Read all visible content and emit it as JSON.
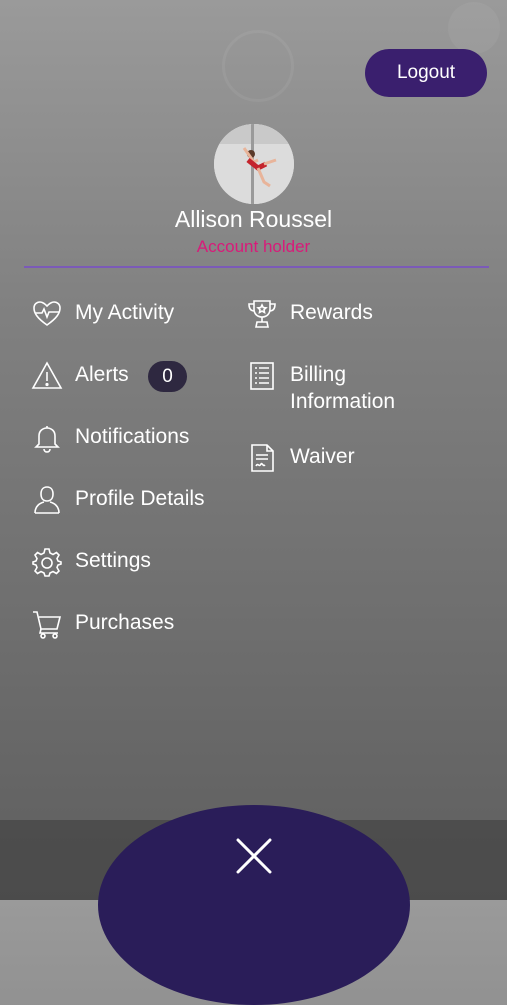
{
  "header": {
    "logout_label": "Logout"
  },
  "user": {
    "name": "Allison Roussel",
    "role": "Account holder"
  },
  "menu": {
    "left": [
      {
        "label": "My Activity",
        "icon": "heart-pulse-icon"
      },
      {
        "label": "Alerts",
        "icon": "warning-icon"
      },
      {
        "label": "Notifications",
        "icon": "bell-icon"
      },
      {
        "label": "Profile Details",
        "icon": "person-icon"
      },
      {
        "label": "Settings",
        "icon": "gear-icon"
      },
      {
        "label": "Purchases",
        "icon": "cart-icon"
      }
    ],
    "right": [
      {
        "label": "Rewards",
        "icon": "trophy-icon"
      },
      {
        "label": "Billing\nInformation",
        "icon": "document-list-icon"
      },
      {
        "label": "Waiver",
        "icon": "document-signature-icon"
      }
    ]
  },
  "alerts_count": "0",
  "colors": {
    "accent": "#3a1f6e",
    "role_text": "#d81b7a",
    "divider": "#7b5ab8",
    "close_bg": "#2a1d59",
    "badge_bg": "#2e2840"
  }
}
